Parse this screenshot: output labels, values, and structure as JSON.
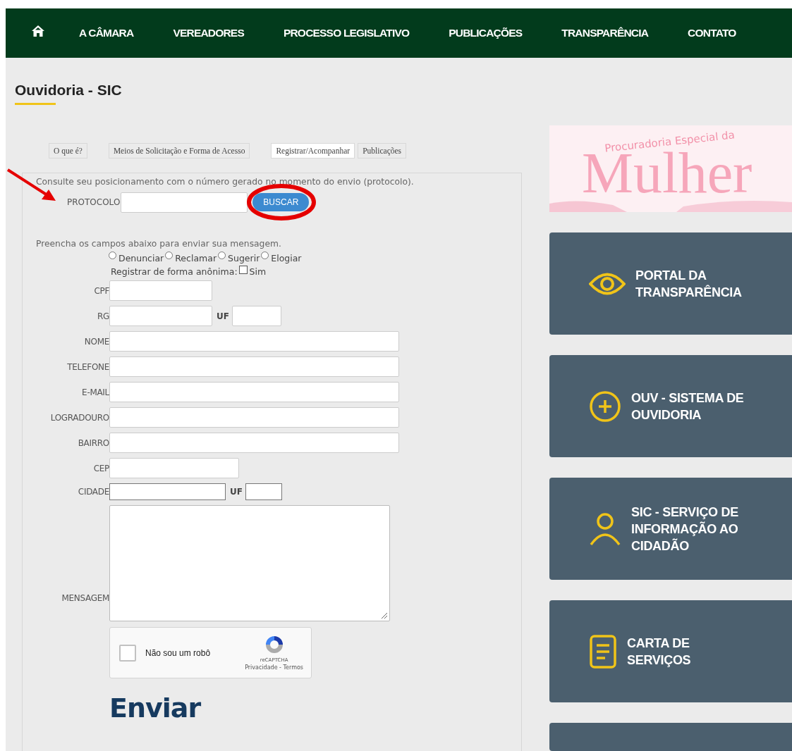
{
  "nav": {
    "items": [
      "A CÂMARA",
      "VEREADORES",
      "PROCESSO LEGISLATIVO",
      "PUBLICAÇÕES",
      "TRANSPARÊNCIA",
      "CONTATO"
    ]
  },
  "page_title": "Ouvidoria - SIC",
  "tabs": [
    {
      "label": "O que é?",
      "selected": false
    },
    {
      "label": "Meios de Solicitação e Forma de Acesso",
      "selected": false
    },
    {
      "label": "Registrar/Acompanhar",
      "selected": true
    },
    {
      "label": "Publicações",
      "selected": false
    }
  ],
  "consult": {
    "text": "Consulte seu posicionamento com o número gerado no momento do envio (protocolo).",
    "label": "PROTOCOLO",
    "button": "BUSCAR"
  },
  "form": {
    "intro": "Preencha os campos abaixo para enviar sua mensagem.",
    "options": [
      {
        "label": "Denunciar",
        "selected": false
      },
      {
        "label": "Reclamar",
        "selected": false
      },
      {
        "label": "Sugerir",
        "selected": false
      },
      {
        "label": "Elogiar",
        "selected": false
      }
    ],
    "anonymous": {
      "label": "Registrar de forma anônima:",
      "option": "Sim",
      "checked": false
    },
    "fields": [
      {
        "kind": "short",
        "label": "CPF"
      },
      {
        "kind": "short_uf",
        "label": "RG",
        "uf_label": "UF"
      },
      {
        "kind": "long",
        "label": "NOME"
      },
      {
        "kind": "long",
        "label": "TELEFONE"
      },
      {
        "kind": "long",
        "label": "E-MAIL"
      },
      {
        "kind": "long",
        "label": "LOGRADOURO"
      },
      {
        "kind": "long",
        "label": "BAIRRO"
      },
      {
        "kind": "medium",
        "label": "CEP"
      },
      {
        "kind": "city_uf",
        "label": "CIDADE",
        "uf_label": "UF"
      },
      {
        "kind": "textarea",
        "label": "MENSAGEM"
      }
    ],
    "captcha": {
      "label": "Não sou um robô",
      "checked": false,
      "brand": "reCAPTCHA",
      "links": "Privacidade - Termos"
    },
    "submit": "Enviar"
  },
  "banner": {
    "subtitle": "Procuradoria Especial da",
    "title": "Mulher"
  },
  "cards": [
    {
      "kind": "eye",
      "label": "PORTAL DA TRANSPARÊNCIA"
    },
    {
      "kind": "plus",
      "label": "OUV - SISTEMA DE OUVIDORIA"
    },
    {
      "kind": "person",
      "label": "SIC - SERVIÇO DE INFORMAÇÃO AO CIDADÃO"
    },
    {
      "kind": "document",
      "label": "CARTA DE SERVIÇOS"
    }
  ]
}
